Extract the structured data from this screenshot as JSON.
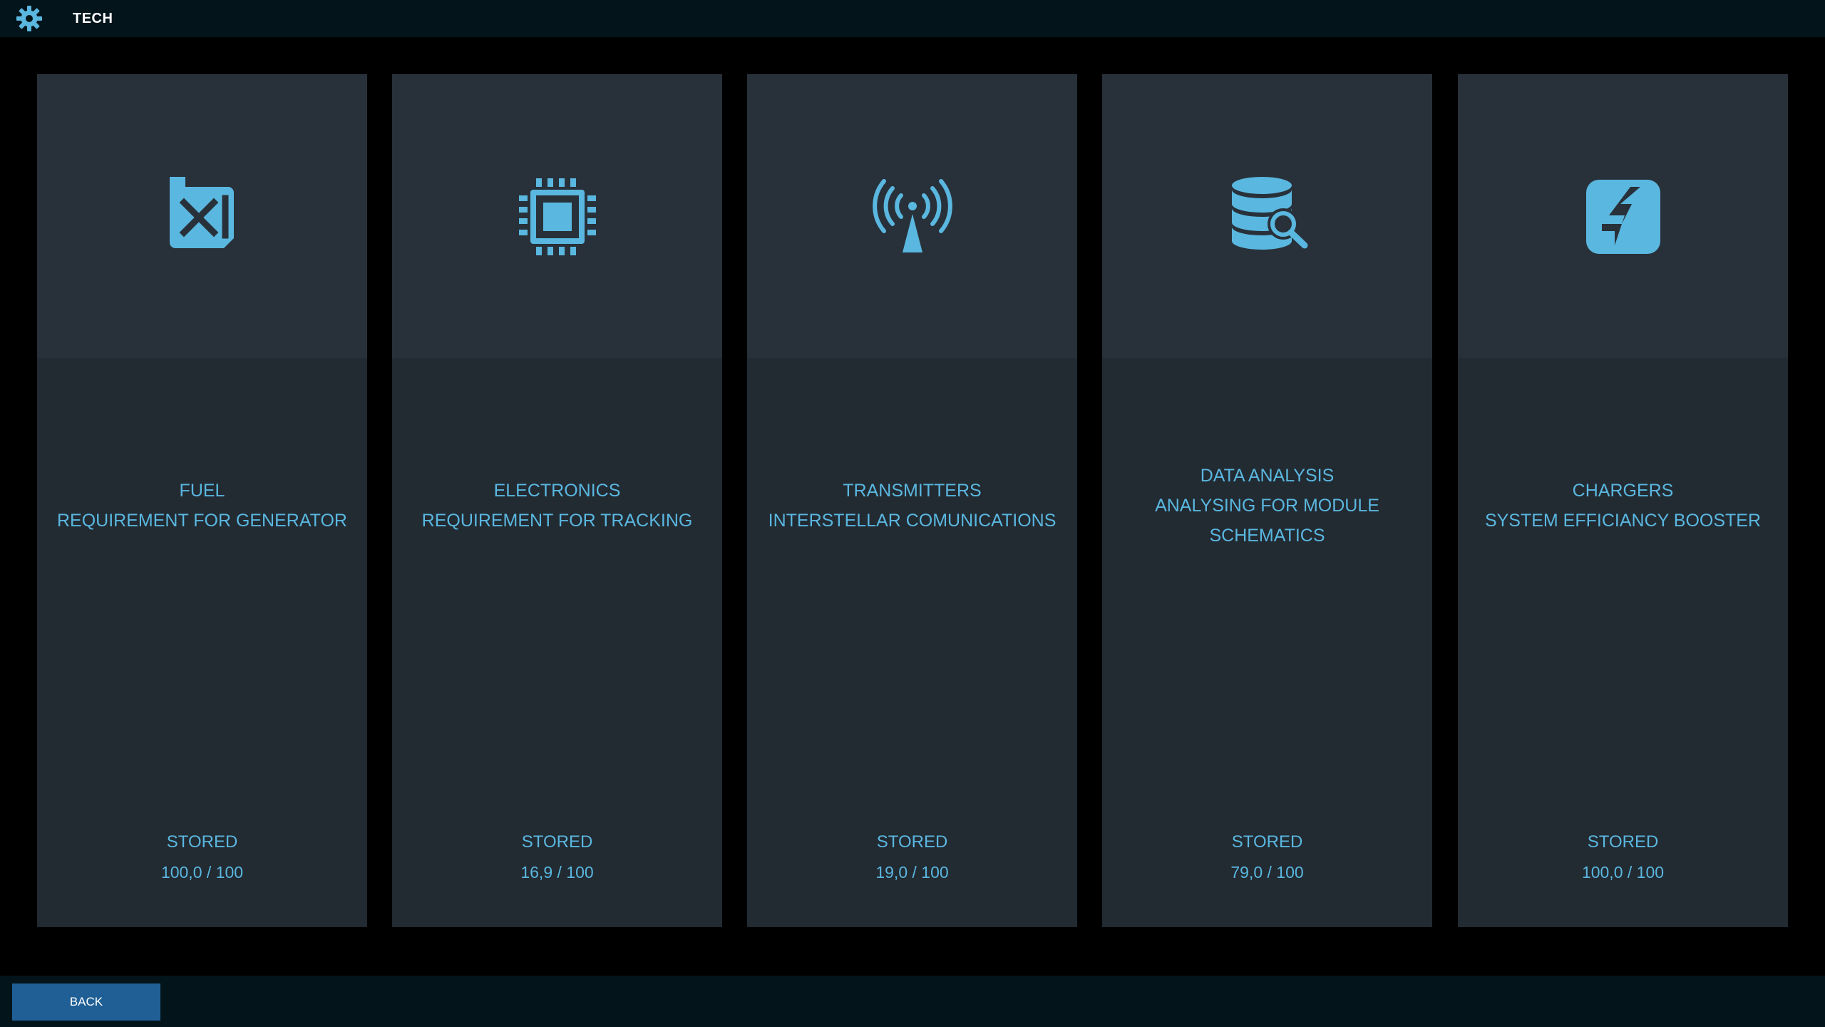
{
  "header": {
    "title": "TECH",
    "icon": "gear-icon"
  },
  "colors": {
    "accent": "#5ab7df",
    "card_bg": "#222a32",
    "card_icon_bg": "#28313a",
    "bar_bg": "#03141b",
    "button_bg": "#1f5f95"
  },
  "cards": [
    {
      "icon": "fuel-can-icon",
      "lines": [
        "FUEL",
        "REQUIREMENT FOR GENERATOR"
      ],
      "stored_label": "STORED",
      "amount": "100,0 / 100"
    },
    {
      "icon": "chip-icon",
      "lines": [
        "ELECTRONICS",
        "REQUIREMENT FOR TRACKING"
      ],
      "stored_label": "STORED",
      "amount": "16,9 / 100"
    },
    {
      "icon": "antenna-icon",
      "lines": [
        "TRANSMITTERS",
        "INTERSTELLAR COMUNICATIONS"
      ],
      "stored_label": "STORED",
      "amount": "19,0 / 100"
    },
    {
      "icon": "database-search-icon",
      "lines": [
        "DATA ANALYSIS",
        "ANALYSING FOR MODULE",
        "SCHEMATICS"
      ],
      "stored_label": "STORED",
      "amount": "79,0 / 100"
    },
    {
      "icon": "charger-icon",
      "lines": [
        "CHARGERS",
        "SYSTEM EFFICIANCY BOOSTER"
      ],
      "stored_label": "STORED",
      "amount": "100,0 / 100"
    }
  ],
  "footer": {
    "back_label": "BACK"
  }
}
